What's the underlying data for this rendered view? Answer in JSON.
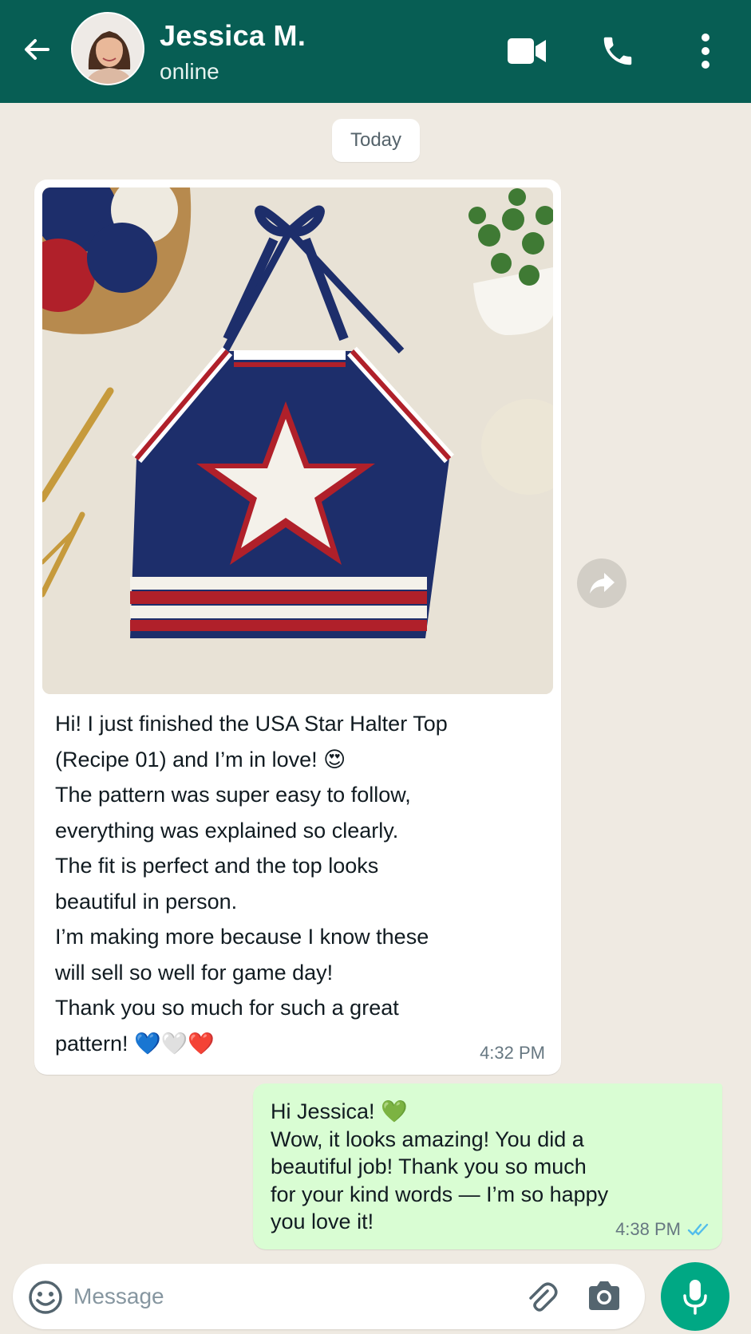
{
  "colors": {
    "header": "#075e54",
    "chat_background": "#efeae2",
    "incoming_bubble": "#ffffff",
    "outgoing_bubble": "#d9fdd3",
    "mic_button": "#00a884",
    "read_ticks": "#53bdeb"
  },
  "header": {
    "contact_name": "Jessica M.",
    "status": "online",
    "icons": [
      "back-arrow-icon",
      "video-call-icon",
      "phone-icon",
      "more-vertical-icon"
    ]
  },
  "chat": {
    "date_chip": "Today",
    "incoming": {
      "image_subject": "crochet-halter-top-photo",
      "lines": [
        "Hi! I just finished the USA Star Halter Top",
        "(Recipe 01) and I’m in love! 😍",
        "The pattern was super easy to follow,",
        "everything was explained so clearly.",
        "The fit is perfect and the top looks",
        "beautiful in person.",
        "I’m making more because I know these",
        "will sell so well for game day!",
        "Thank you so much for such a great",
        "pattern! 💙🤍❤️"
      ],
      "time": "4:32 PM"
    },
    "outgoing": {
      "lines": [
        "Hi Jessica! 💚",
        "Wow, it looks amazing! You did a",
        "beautiful job! Thank you so much",
        "for your kind words — I’m so happy",
        "you love it!"
      ],
      "time": "4:38 PM",
      "status_icon": "double-check-icon"
    }
  },
  "input": {
    "placeholder": "Message",
    "value": "",
    "icons": [
      "emoji-icon",
      "attach-icon",
      "camera-icon",
      "mic-icon"
    ]
  }
}
